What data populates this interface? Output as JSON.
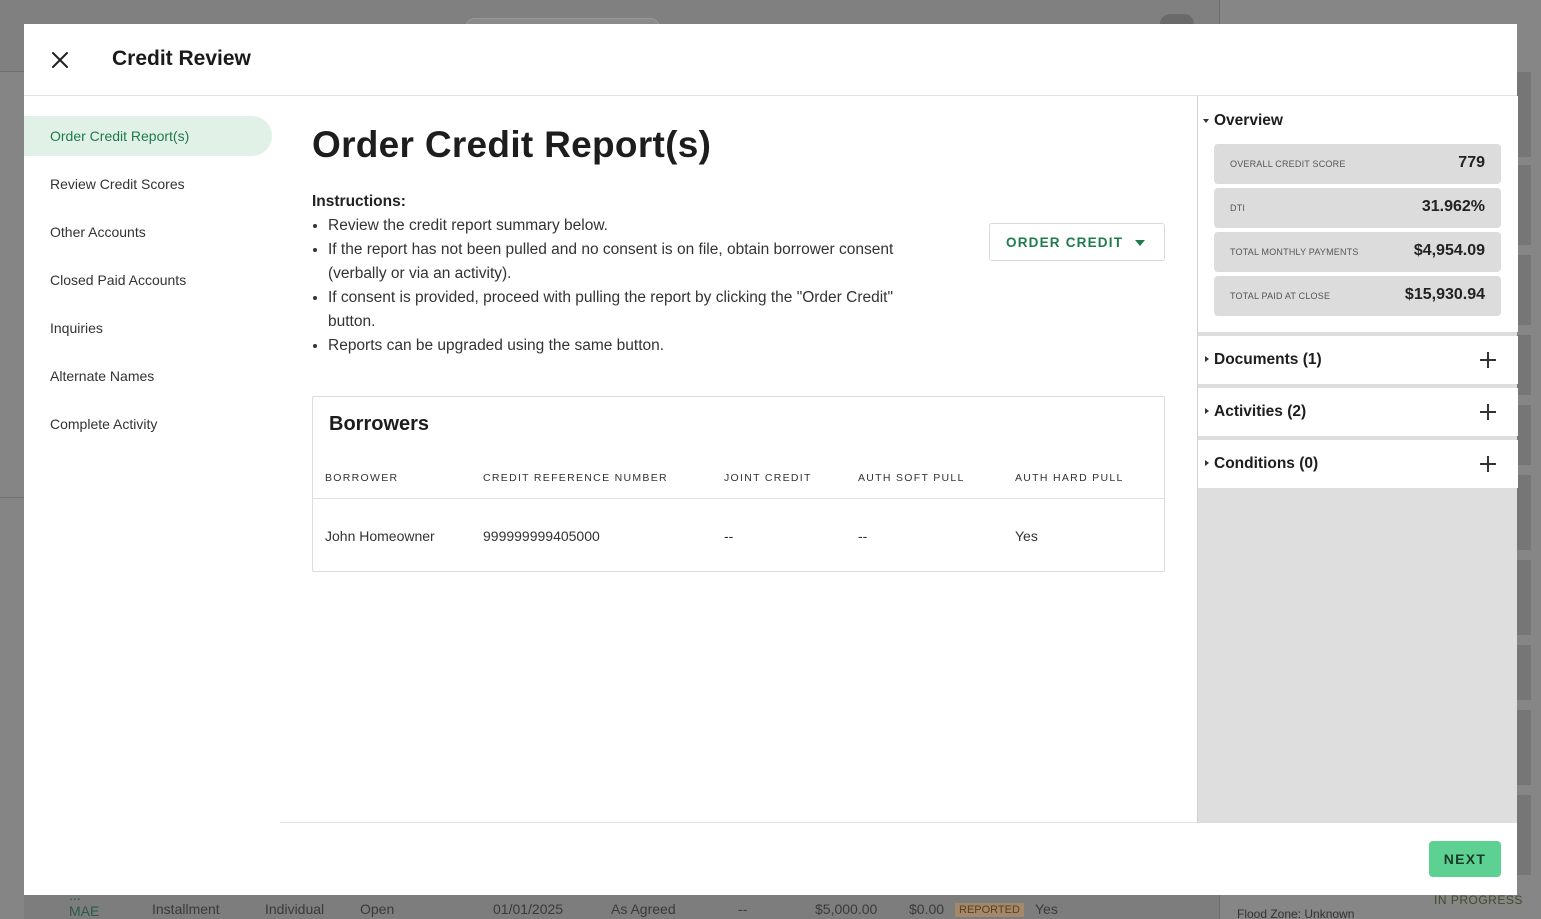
{
  "background": {
    "row": {
      "lender_line1": "...",
      "lender_line2": "MAE",
      "type": "Installment",
      "ownership": "Individual",
      "status": "Open",
      "date": "01/01/2025",
      "rating": "As Agreed",
      "dash": "--",
      "amount": "$5,000.00",
      "balance": "$0.00",
      "badge": "REPORTED",
      "flag": "Yes"
    },
    "side_status": "IN PROGRESS",
    "flood_zone": "Flood Zone: Unknown"
  },
  "modal": {
    "title": "Credit Review",
    "close_icon": "close-icon"
  },
  "nav": {
    "items": [
      {
        "label": "Order Credit Report(s)",
        "active": true
      },
      {
        "label": "Review Credit Scores",
        "active": false
      },
      {
        "label": "Other Accounts",
        "active": false
      },
      {
        "label": "Closed Paid Accounts",
        "active": false
      },
      {
        "label": "Inquiries",
        "active": false
      },
      {
        "label": "Alternate Names",
        "active": false
      },
      {
        "label": "Complete Activity",
        "active": false
      }
    ]
  },
  "main": {
    "title": "Order Credit Report(s)",
    "instructions_label": "Instructions:",
    "instructions": [
      "Review the credit report summary below.",
      "If the report has not been pulled and no consent is on file, obtain borrower consent (verbally or via an activity).",
      "If consent is provided, proceed with pulling the report by clicking the \"Order Credit\" button.",
      "Reports can be upgraded using the same button."
    ],
    "order_button": "ORDER CREDIT",
    "borrowers": {
      "title": "Borrowers",
      "columns": [
        "BORROWER",
        "CREDIT REFERENCE NUMBER",
        "JOINT CREDIT",
        "AUTH SOFT PULL",
        "AUTH HARD PULL"
      ],
      "rows": [
        [
          "John Homeowner",
          "999999999405000",
          "--",
          "--",
          "Yes"
        ]
      ]
    }
  },
  "overview": {
    "title": "Overview",
    "stats": [
      {
        "label": "OVERALL CREDIT SCORE",
        "value": "779"
      },
      {
        "label": "DTI",
        "value": "31.962%"
      },
      {
        "label": "TOTAL MONTHLY PAYMENTS",
        "value": "$4,954.09"
      },
      {
        "label": "TOTAL PAID AT CLOSE",
        "value": "$15,930.94"
      }
    ],
    "sections": [
      {
        "label": "Documents (1)"
      },
      {
        "label": "Activities (2)"
      },
      {
        "label": "Conditions (0)"
      }
    ]
  },
  "footer": {
    "next_button": "NEXT"
  },
  "colors": {
    "accent": "#1f7a4d",
    "nav_active_bg": "#e2f1e8",
    "next_button_bg": "#5cd192"
  }
}
